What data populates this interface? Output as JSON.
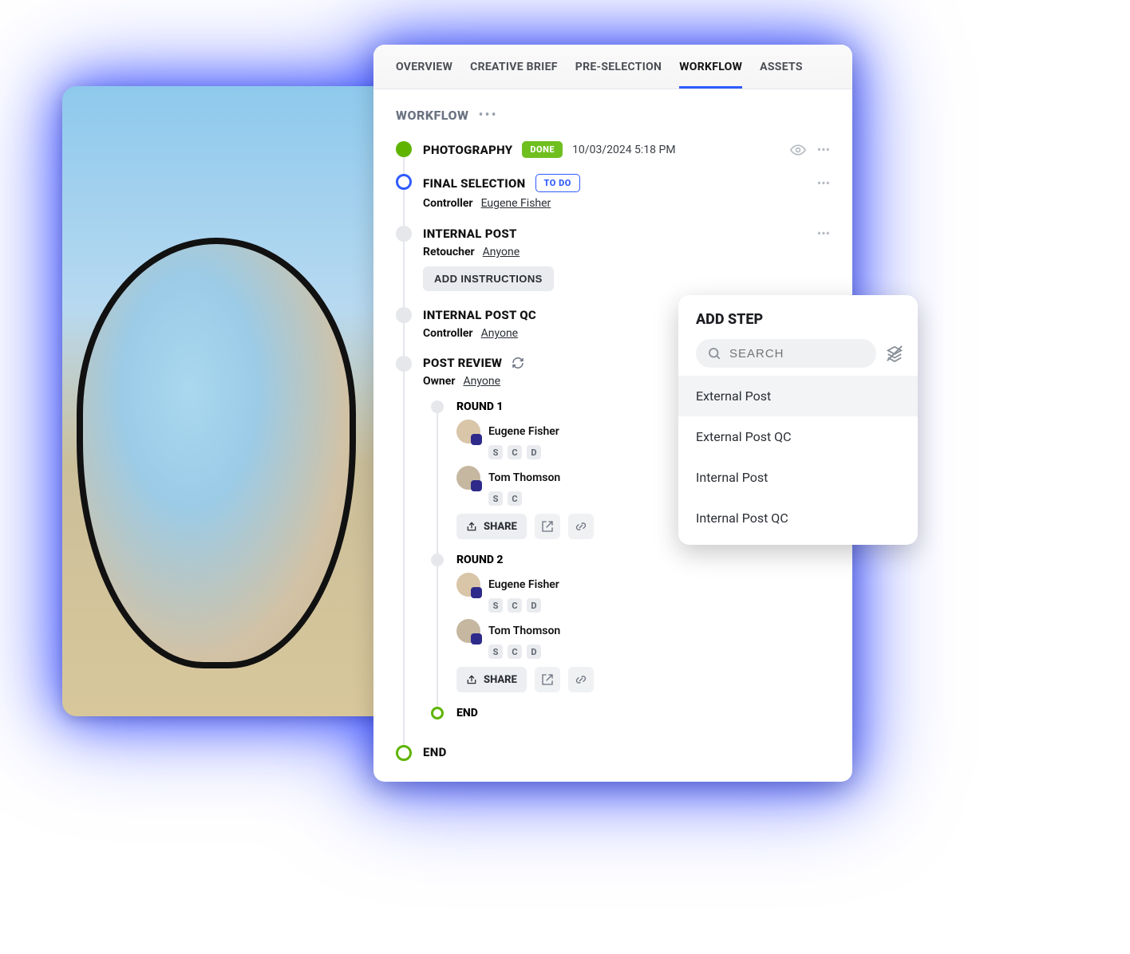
{
  "tabs": {
    "overview": "OVERVIEW",
    "creative_brief": "CREATIVE BRIEF",
    "pre_selection": "PRE-SELECTION",
    "workflow": "WORKFLOW",
    "assets": "ASSETS",
    "active": "workflow"
  },
  "section": {
    "title": "WORKFLOW"
  },
  "steps": {
    "photography": {
      "title": "PHOTOGRAPHY",
      "status_label": "DONE",
      "timestamp": "10/03/2024 5:18 PM"
    },
    "final_selection": {
      "title": "FINAL SELECTION",
      "status_label": "TO DO",
      "role_label": "Controller",
      "role_value": "Eugene Fisher"
    },
    "internal_post": {
      "title": "INTERNAL POST",
      "role_label": "Retoucher",
      "role_value": "Anyone",
      "add_instructions_label": "ADD INSTRUCTIONS"
    },
    "internal_post_qc": {
      "title": "INTERNAL POST QC",
      "role_label": "Controller",
      "role_value": "Anyone"
    },
    "post_review": {
      "title": "POST REVIEW",
      "role_label": "Owner",
      "role_value": "Anyone",
      "rounds": [
        {
          "title": "ROUND 1",
          "people": [
            {
              "name": "Eugene Fisher",
              "chips": [
                "S",
                "C",
                "D"
              ]
            },
            {
              "name": "Tom Thomson",
              "chips": [
                "S",
                "C"
              ]
            }
          ],
          "share_label": "SHARE"
        },
        {
          "title": "ROUND 2",
          "people": [
            {
              "name": "Eugene Fisher",
              "chips": [
                "S",
                "C",
                "D"
              ]
            },
            {
              "name": "Tom Thomson",
              "chips": [
                "S",
                "C",
                "D"
              ]
            }
          ],
          "share_label": "SHARE"
        }
      ],
      "end_label": "END"
    },
    "end": {
      "title": "END"
    }
  },
  "add_step": {
    "title": "ADD STEP",
    "search_placeholder": "SEARCH",
    "options": [
      "External Post",
      "External Post QC",
      "Internal Post",
      "Internal Post QC"
    ]
  }
}
